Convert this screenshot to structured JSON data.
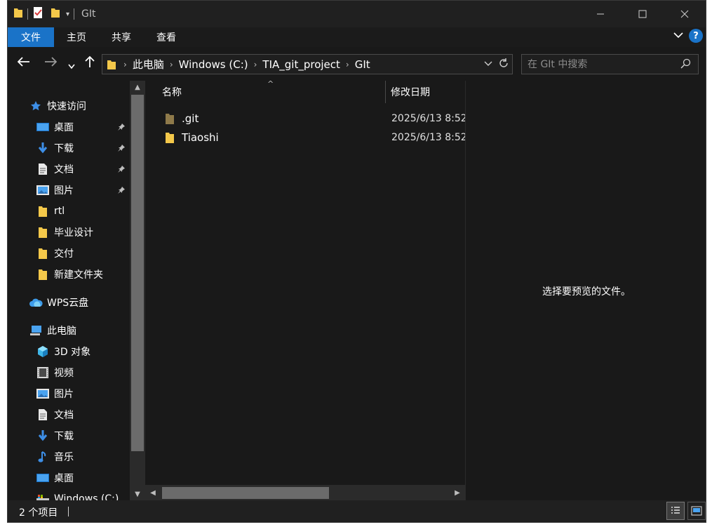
{
  "window": {
    "title": "GIt"
  },
  "ribbon": {
    "tabs": [
      "文件",
      "主页",
      "共享",
      "查看"
    ]
  },
  "address": {
    "crumbs": [
      "此电脑",
      "Windows  (C:)",
      "TIA_git_project",
      "GIt"
    ],
    "search_placeholder": "在 GIt 中搜索"
  },
  "navpane": {
    "quick_access": "快速访问",
    "pinned": [
      {
        "label": "桌面",
        "icon": "desktop-icon"
      },
      {
        "label": "下载",
        "icon": "download-icon"
      },
      {
        "label": "文档",
        "icon": "document-icon"
      },
      {
        "label": "图片",
        "icon": "picture-icon"
      }
    ],
    "folders": [
      "rtl",
      "毕业设计",
      "交付",
      "新建文件夹"
    ],
    "wps": "WPS云盘",
    "this_pc": "此电脑",
    "pc_items": [
      {
        "label": "3D 对象",
        "icon": "3d-objects-icon"
      },
      {
        "label": "视频",
        "icon": "video-icon"
      },
      {
        "label": "图片",
        "icon": "picture-icon"
      },
      {
        "label": "文档",
        "icon": "document-icon"
      },
      {
        "label": "下载",
        "icon": "download-icon"
      },
      {
        "label": "音乐",
        "icon": "music-icon"
      },
      {
        "label": "桌面",
        "icon": "desktop-icon"
      },
      {
        "label": "Windows  (C:)",
        "icon": "drive-icon"
      }
    ]
  },
  "filelist": {
    "columns": {
      "name": "名称",
      "modified": "修改日期"
    },
    "rows": [
      {
        "name": ".git",
        "modified": "2025/6/13 8:52",
        "hidden": true
      },
      {
        "name": "Tiaoshi",
        "modified": "2025/6/13 8:52",
        "hidden": false
      }
    ]
  },
  "preview": {
    "message": "选择要预览的文件。"
  },
  "status": {
    "item_count": "2 个项目"
  },
  "colors": {
    "accent": "#1a73c8",
    "folder": "#f4c84a",
    "background": "#191919"
  }
}
